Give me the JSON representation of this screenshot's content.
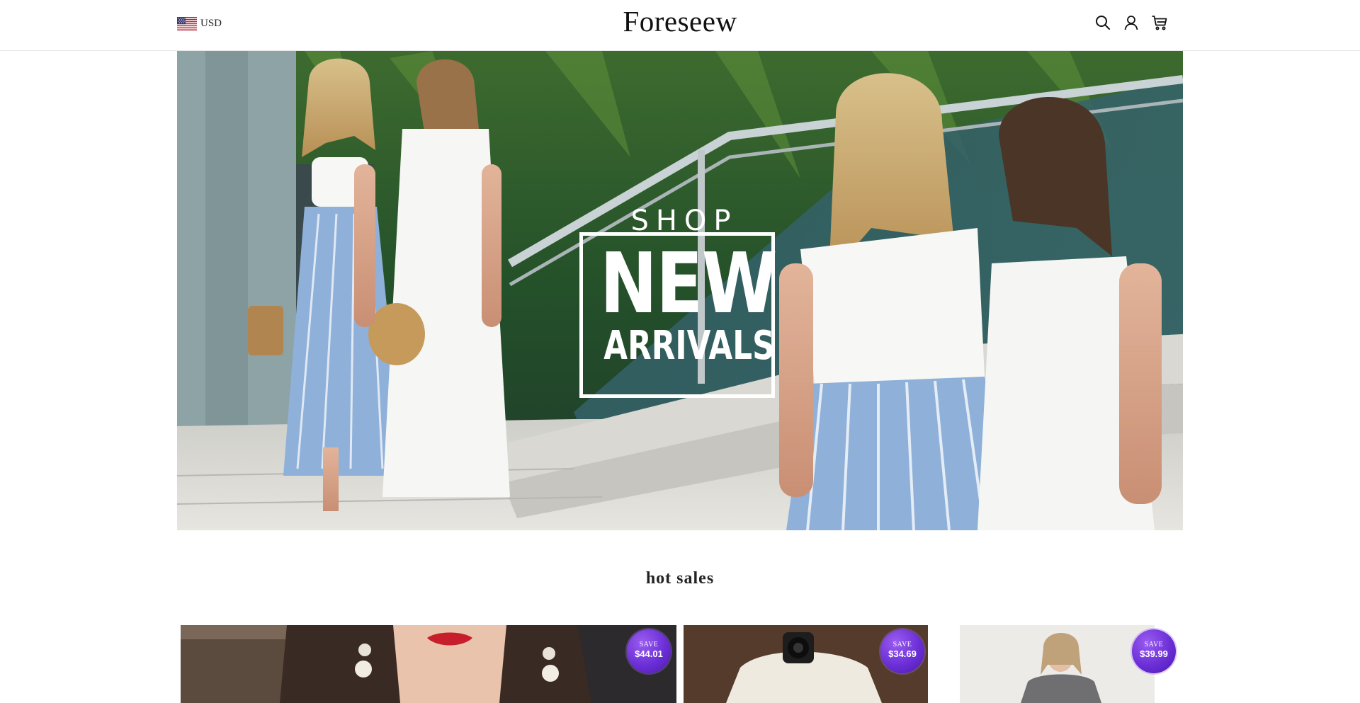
{
  "header": {
    "currency": "USD",
    "brand": "Foreseew",
    "icons": [
      "search-icon",
      "account-icon",
      "cart-icon"
    ]
  },
  "hero": {
    "shop": "SHOP",
    "new": "NEW",
    "arrivals": "ARRIVALS"
  },
  "section": {
    "title": "hot sales"
  },
  "products": [
    {
      "save_label": "SAVE",
      "save_amount": "$44.01"
    },
    {
      "save_label": "SAVE",
      "save_amount": "$34.69"
    },
    {
      "save_label": "SAVE",
      "save_amount": "$39.99"
    }
  ],
  "colors": {
    "badge": "#6b2fd6",
    "border": "#e6e6e6",
    "text": "#111111"
  }
}
